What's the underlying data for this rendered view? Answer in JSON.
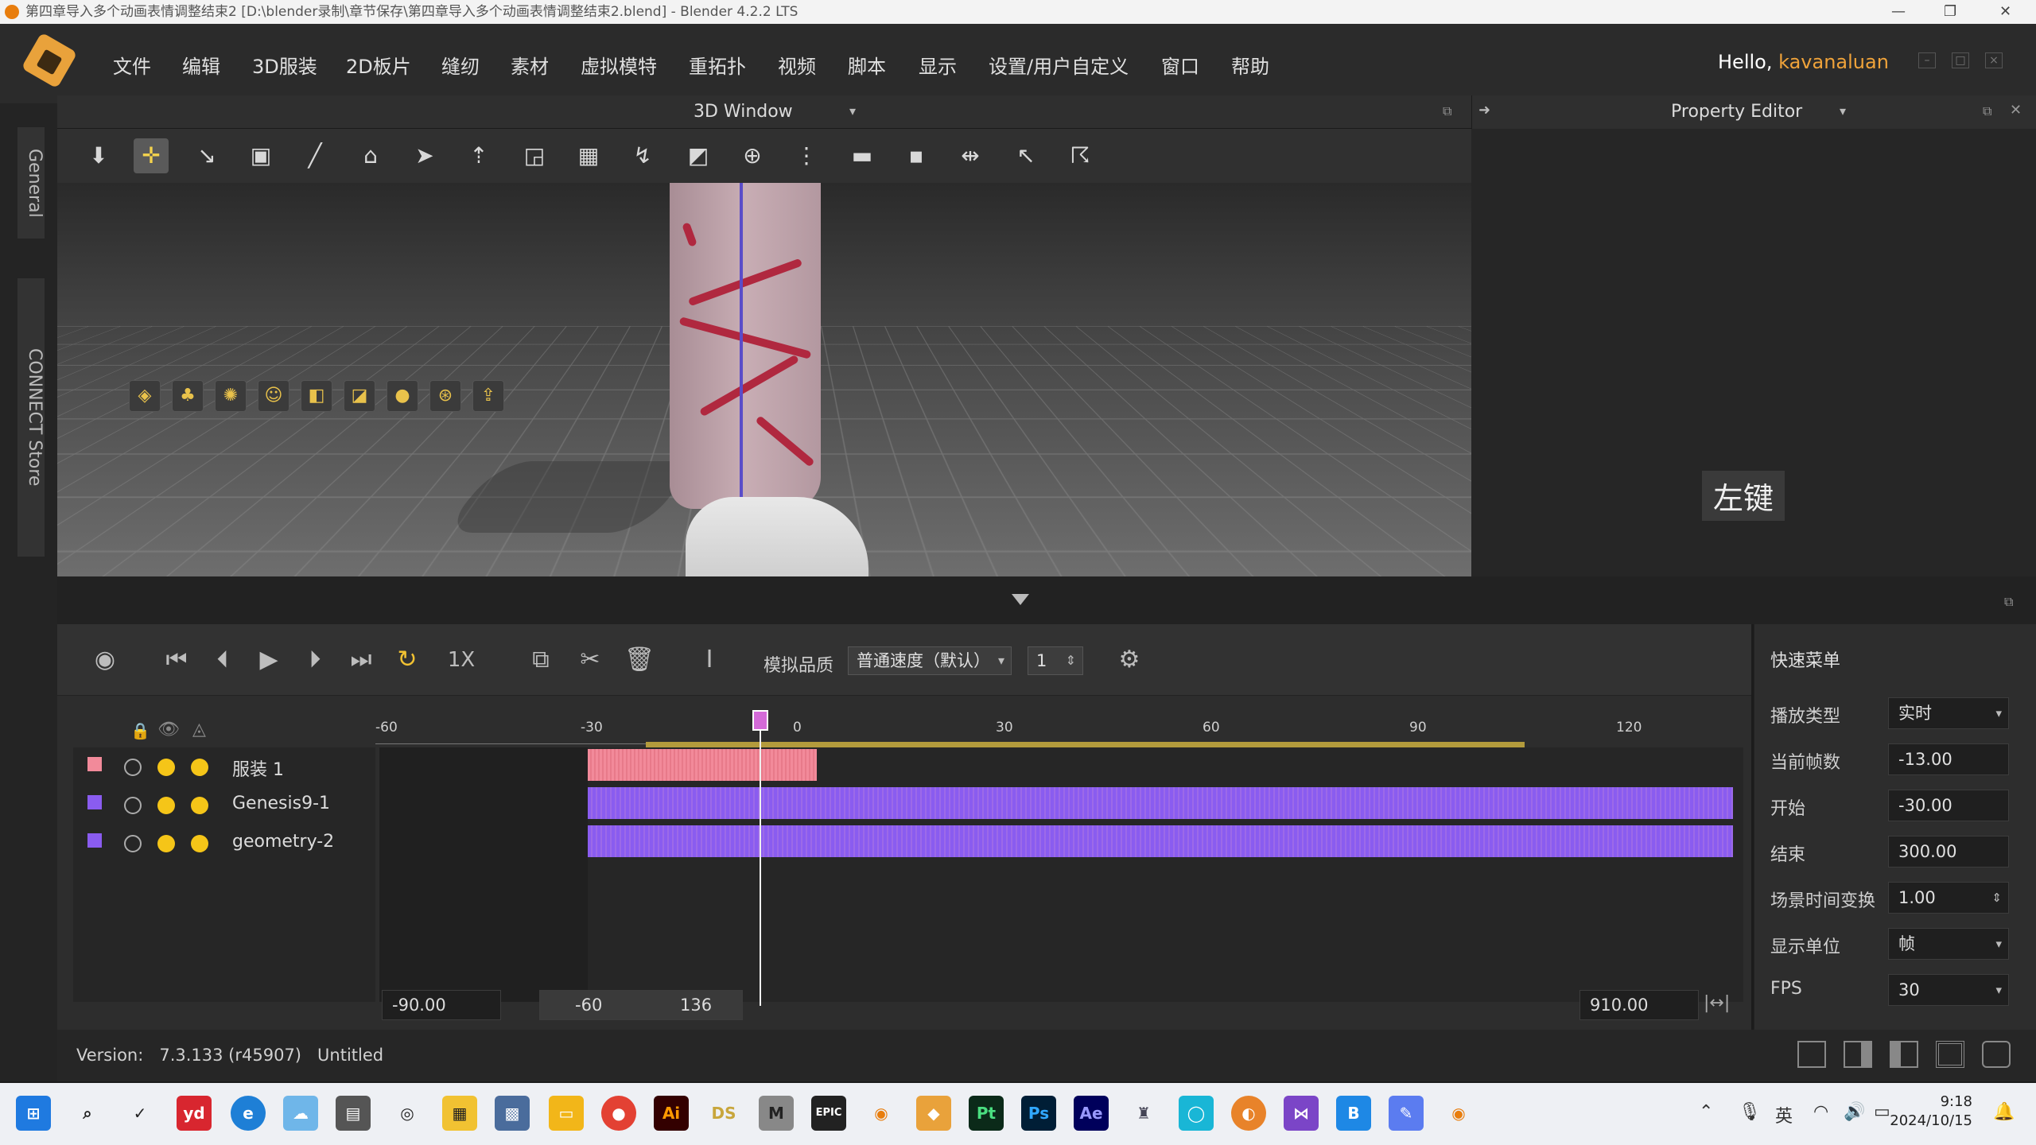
{
  "os_title": "第四章导入多个动画表情调整结束2 [D:\\blender录制\\章节保存\\第四章导入多个动画表情调整结束2.blend] - Blender 4.2.2 LTS",
  "os_controls": [
    "—",
    "❐",
    "✕"
  ],
  "menu": [
    "文件",
    "编辑",
    "3D服装",
    "2D板片",
    "缝纫",
    "素材",
    "虚拟模特",
    "重拓扑",
    "视频",
    "脚本",
    "显示",
    "设置/用户自定义",
    "窗口",
    "帮助"
  ],
  "user": {
    "greeting": "Hello, ",
    "name": "kavanaluan"
  },
  "side_tabs": [
    "General",
    "CONNECT Store"
  ],
  "window3d": {
    "title": "3D Window"
  },
  "property_editor": {
    "title": "Property Editor",
    "overlay_text": "左键"
  },
  "timeline": {
    "speed_label": "1X",
    "quality_label": "模拟品质",
    "quality_value": "普通速度（默认）",
    "step_value": "1",
    "ruler_ticks": [
      "-60",
      "-30",
      "0",
      "30",
      "60",
      "90",
      "120"
    ],
    "tracks": [
      {
        "name": "服装 1",
        "color": "#f28a9a",
        "clip_color": "#f28a9a"
      },
      {
        "name": "Genesis9-1",
        "color": "#8a5cf0",
        "clip_color": "#8a5cf0"
      },
      {
        "name": "geometry-2",
        "color": "#8a5cf0",
        "clip_color": "#8a5cf0"
      }
    ],
    "range_start": "-90.00",
    "view_start": "-60",
    "view_end": "136",
    "range_end": "910.00"
  },
  "quick_menu": {
    "title": "快速菜单",
    "fields": [
      {
        "label": "播放类型",
        "value": "实时",
        "dropdown": true
      },
      {
        "label": "当前帧数",
        "value": "-13.00"
      },
      {
        "label": "开始",
        "value": "-30.00"
      },
      {
        "label": "结束",
        "value": "300.00"
      },
      {
        "label": "场景时间变换",
        "value": "1.00",
        "spinner": true
      },
      {
        "label": "显示单位",
        "value": "帧",
        "dropdown": true
      },
      {
        "label": "FPS",
        "value": "30",
        "dropdown": true
      }
    ]
  },
  "status": {
    "version_label": "Version:",
    "version": "7.3.133 (r45907)",
    "file": "Untitled"
  },
  "taskbar": {
    "apps": [
      "yd",
      "Ai",
      "DS",
      "M",
      "EPIC",
      "Pt",
      "Ps",
      "Ae"
    ],
    "tray_lang": "英",
    "time": "9:18",
    "date": "2024/10/15"
  },
  "colors": {
    "accent": "#f0a33a",
    "playhead": "#d46ad8",
    "ruler": "#b39b3c"
  }
}
